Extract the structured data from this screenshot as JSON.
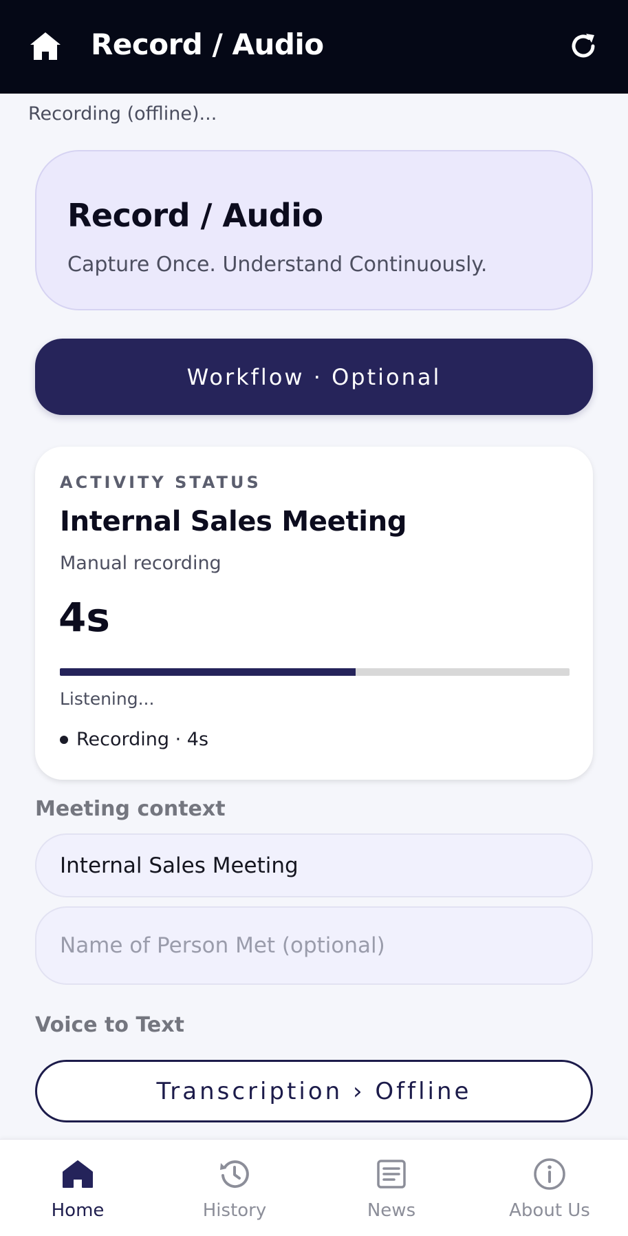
{
  "header": {
    "title": "Record / Audio"
  },
  "status_line": "Recording (offline)...",
  "hero": {
    "title": "Record / Audio",
    "subtitle": "Capture Once. Understand Continuously."
  },
  "workflow_button": {
    "label": "Workflow  ·  Optional"
  },
  "activity": {
    "eyebrow": "ACTIVITY STATUS",
    "title": "Internal Sales Meeting",
    "subtitle": "Manual recording",
    "timer": "4s",
    "progress_fraction": 0.58,
    "listening_text": "Listening...",
    "recording_text": "Recording · 4s"
  },
  "meeting_context": {
    "label": "Meeting context",
    "meeting_name_value": "Internal Sales Meeting",
    "person_placeholder": "Name of Person Met (optional)"
  },
  "voice_to_text": {
    "label": "Voice to Text",
    "transcription_button": "Transcription › Offline"
  },
  "bottom_nav": {
    "items": [
      {
        "label": "Home",
        "icon": "home-icon",
        "active": true
      },
      {
        "label": "History",
        "icon": "history-icon",
        "active": false
      },
      {
        "label": "News",
        "icon": "news-icon",
        "active": false
      },
      {
        "label": "About Us",
        "icon": "info-icon",
        "active": false
      }
    ]
  },
  "colors": {
    "header_bg": "#050816",
    "accent_navy": "#26245a",
    "hero_bg": "#ebe9fc",
    "progress_track": "#d8d8d8",
    "nav_active": "#1f1e4e",
    "nav_inactive": "#8c8e99"
  }
}
